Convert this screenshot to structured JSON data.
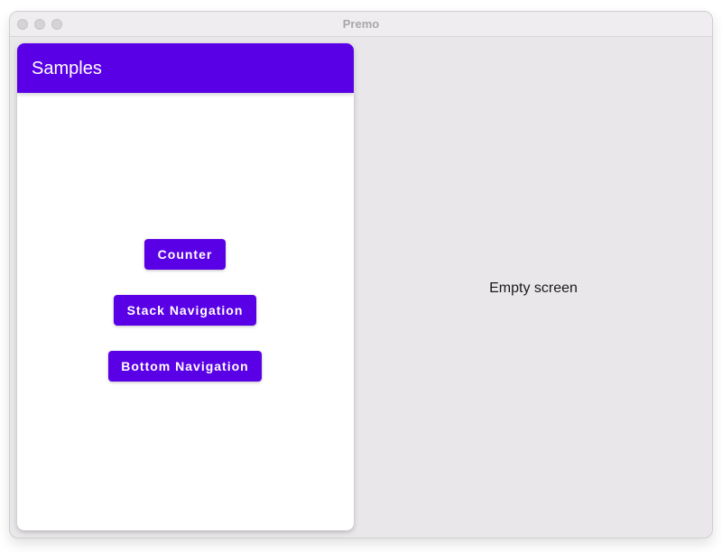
{
  "window": {
    "title": "Premo"
  },
  "app_bar": {
    "title": "Samples"
  },
  "buttons": {
    "counter": "Counter",
    "stack_navigation": "Stack Navigation",
    "bottom_navigation": "Bottom Navigation"
  },
  "detail": {
    "empty_text": "Empty screen"
  },
  "colors": {
    "primary": "#5a00e6",
    "window_background": "#e9e7ea",
    "panel_background": "#ffffff"
  }
}
